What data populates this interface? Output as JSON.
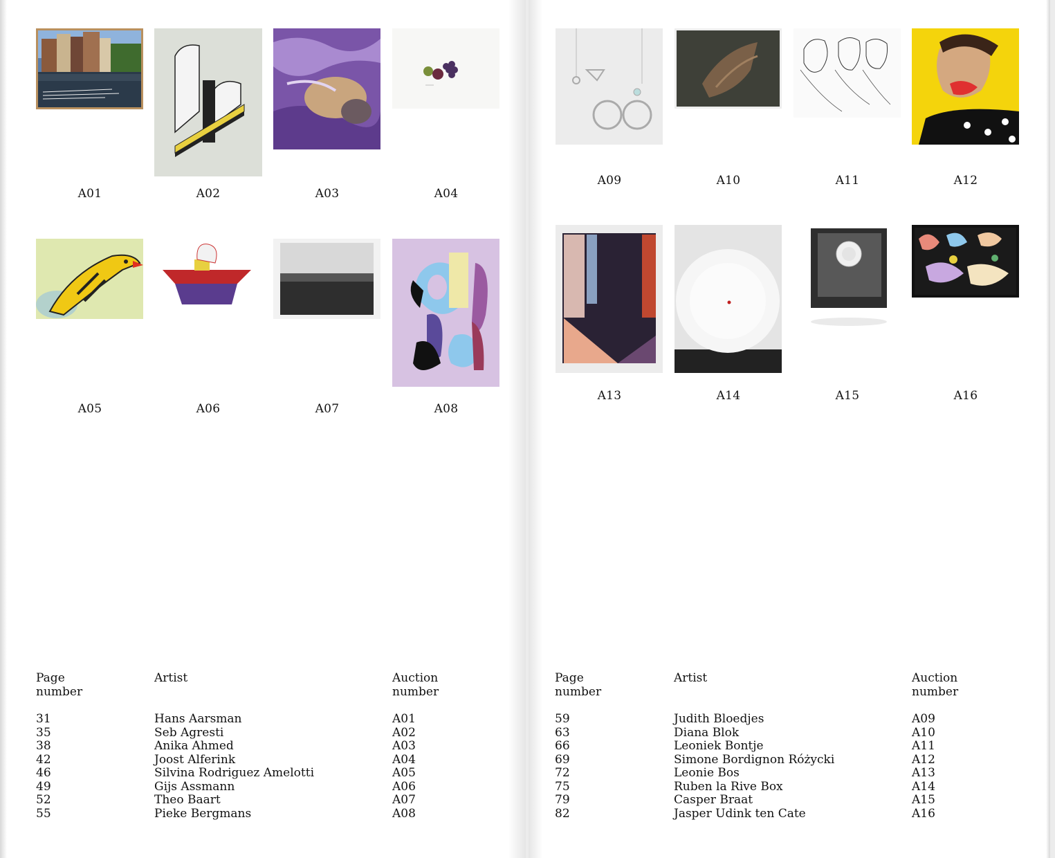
{
  "left_page": {
    "artworks": [
      {
        "code": "A01",
        "caption": "Hans Aarsman"
      },
      {
        "code": "A02",
        "caption": "Seb Agresti"
      },
      {
        "code": "A03",
        "caption": "Anika Ahmed"
      },
      {
        "code": "A04",
        "caption": "Joost Alferink"
      },
      {
        "code": "A05",
        "caption": "Silvina Rodriguez Amelotti"
      },
      {
        "code": "A06",
        "caption": "Gijs Assmann"
      },
      {
        "code": "A07",
        "caption": "Theo Baart"
      },
      {
        "code": "A08",
        "caption": "Pieke Bergmans"
      }
    ],
    "table": {
      "headers": {
        "page_line1": "Page",
        "page_line2": "number",
        "artist": "Artist",
        "auction_line1": "Auction",
        "auction_line2": "number"
      },
      "rows": [
        {
          "page": "31",
          "artist": "Hans Aarsman",
          "auction": "A01"
        },
        {
          "page": "35",
          "artist": "Seb Agresti",
          "auction": "A02"
        },
        {
          "page": "38",
          "artist": "Anika Ahmed",
          "auction": "A03"
        },
        {
          "page": "42",
          "artist": "Joost Alferink",
          "auction": "A04"
        },
        {
          "page": "46",
          "artist": "Silvina Rodriguez Amelotti",
          "auction": "A05"
        },
        {
          "page": "49",
          "artist": "Gijs Assmann",
          "auction": "A06"
        },
        {
          "page": "52",
          "artist": "Theo Baart",
          "auction": "A07"
        },
        {
          "page": "55",
          "artist": "Pieke Bergmans",
          "auction": "A08"
        }
      ]
    }
  },
  "right_page": {
    "artworks": [
      {
        "code": "A09"
      },
      {
        "code": "A10"
      },
      {
        "code": "A11"
      },
      {
        "code": "A12"
      },
      {
        "code": "A13"
      },
      {
        "code": "A14"
      },
      {
        "code": "A15"
      },
      {
        "code": "A16"
      }
    ],
    "table": {
      "headers": {
        "page_line1": "Page",
        "page_line2": "number",
        "artist": "Artist",
        "auction_line1": "Auction",
        "auction_line2": "number"
      },
      "rows": [
        {
          "page": "59",
          "artist": "Judith Bloedjes",
          "auction": "A09"
        },
        {
          "page": "63",
          "artist": "Diana Blok",
          "auction": "A10"
        },
        {
          "page": "66",
          "artist": "Leoniek Bontje",
          "auction": "A11"
        },
        {
          "page": "69",
          "artist": "Simone Bordignon Różycki",
          "auction": "A12"
        },
        {
          "page": "72",
          "artist": "Leonie Bos",
          "auction": "A13"
        },
        {
          "page": "75",
          "artist": "Ruben la Rive Box",
          "auction": "A14"
        },
        {
          "page": "79",
          "artist": "Casper Braat",
          "auction": "A15"
        },
        {
          "page": "82",
          "artist": "Jasper Udink ten Cate",
          "auction": "A16"
        }
      ]
    }
  }
}
